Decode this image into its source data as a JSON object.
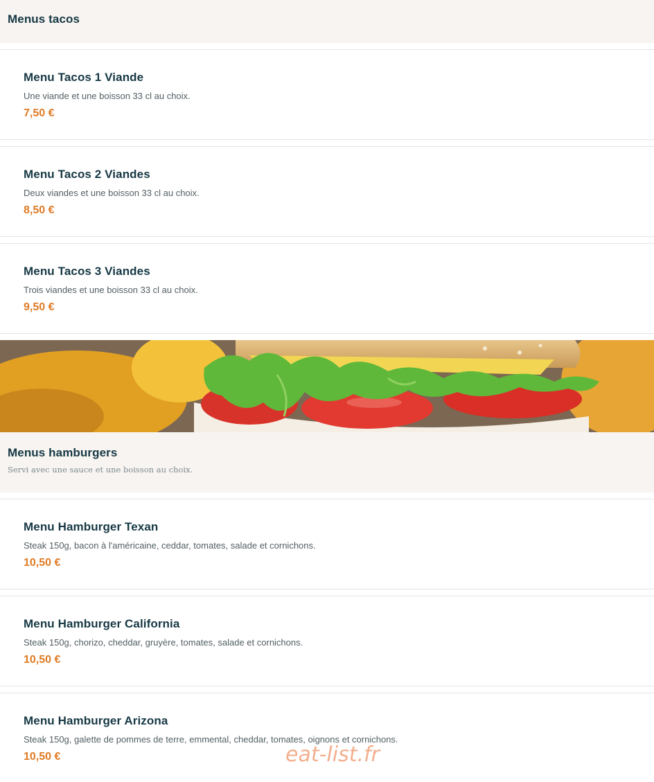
{
  "tacos_section": {
    "title": "Menus tacos",
    "items": [
      {
        "name": "Menu Tacos 1 Viande",
        "description": "Une viande et une boisson 33 cl au choix.",
        "price": "7,50 €"
      },
      {
        "name": "Menu Tacos 2 Viandes",
        "description": "Deux viandes et une boisson 33 cl au choix.",
        "price": "8,50 €"
      },
      {
        "name": "Menu Tacos 3 Viandes",
        "description": "Trois viandes et une boisson 33 cl au choix.",
        "price": "9,50 €"
      }
    ]
  },
  "hamburgers_section": {
    "title": "Menus hamburgers",
    "subtitle": "Servi avec une sauce et une boisson au choix.",
    "items": [
      {
        "name": "Menu Hamburger Texan",
        "description": "Steak 150g, bacon à l'américaine, ceddar, tomates, salade et cornichons.",
        "price": "10,50 €"
      },
      {
        "name": "Menu Hamburger California",
        "description": "Steak 150g, chorizo, cheddar, gruyère, tomates, salade et cornichons.",
        "price": "10,50 €"
      },
      {
        "name": "Menu Hamburger Arizona",
        "description": "Steak 150g, galette de pommes de terre, emmental, cheddar, tomates, oignons et cornichons.",
        "price": "10,50 €"
      }
    ]
  },
  "watermark": "eat-list.fr",
  "colors": {
    "title": "#163844",
    "price": "#e07b24",
    "header_bg": "#f7f4f1"
  }
}
